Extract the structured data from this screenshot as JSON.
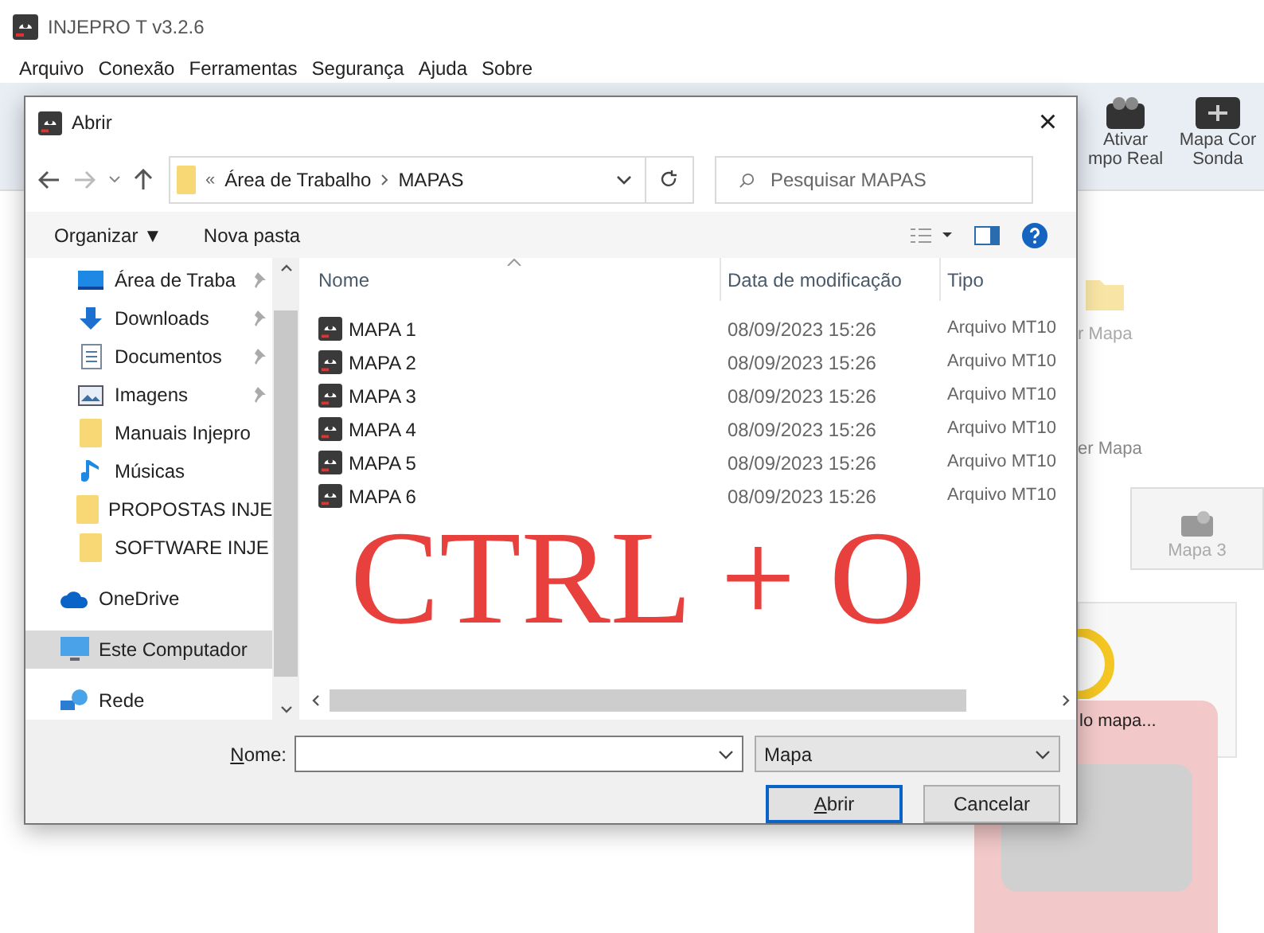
{
  "app": {
    "title": "INJEPRO T v3.2.6",
    "menu": [
      "Arquivo",
      "Conexão",
      "Ferramentas",
      "Segurança",
      "Ajuda",
      "Sobre"
    ],
    "toolbar": [
      {
        "label_lines": [
          "Ativar",
          "mpo Real"
        ],
        "kind": "device"
      },
      {
        "label_lines": [
          "Mapa Cor",
          "Sonda"
        ],
        "kind": "probe"
      }
    ],
    "panel_texts": [
      "r Mapa",
      "er Mapa"
    ],
    "map_card": {
      "label": "Mapa 3"
    },
    "loading_card": {
      "label": "lo mapa..."
    }
  },
  "dialog": {
    "title": "Abrir",
    "close": "×",
    "path": [
      "Área de Trabalho",
      "MAPAS"
    ],
    "path_prefix": "«",
    "search": {
      "placeholder": "Pesquisar MAPAS"
    },
    "commands": [
      "Organizar ▼",
      "Nova pasta"
    ],
    "nav": [
      {
        "label": "Área de Traba",
        "kind": "desktop",
        "pinned": true,
        "selected": false
      },
      {
        "label": "Downloads",
        "kind": "download",
        "pinned": true,
        "selected": false
      },
      {
        "label": "Documentos",
        "kind": "document",
        "pinned": true,
        "selected": false
      },
      {
        "label": "Imagens",
        "kind": "image",
        "pinned": true,
        "selected": false
      },
      {
        "label": "Manuais Injepro",
        "kind": "folder",
        "pinned": false,
        "selected": false
      },
      {
        "label": "Músicas",
        "kind": "music",
        "pinned": false,
        "selected": false
      },
      {
        "label": "PROPOSTAS INJE",
        "kind": "folder",
        "pinned": false,
        "selected": false
      },
      {
        "label": "SOFTWARE INJE",
        "kind": "folder",
        "pinned": false,
        "selected": false
      },
      {
        "label": "OneDrive",
        "kind": "cloud",
        "pinned": false,
        "selected": false
      },
      {
        "label": "Este Computador",
        "kind": "computer",
        "pinned": false,
        "selected": true
      },
      {
        "label": "Rede",
        "kind": "network",
        "pinned": false,
        "selected": false
      }
    ],
    "columns": [
      "Nome",
      "Data de modificação",
      "Tipo"
    ],
    "files": [
      {
        "name": "MAPA 1",
        "date": "08/09/2023 15:26",
        "type": "Arquivo MT10"
      },
      {
        "name": "MAPA 2",
        "date": "08/09/2023 15:26",
        "type": "Arquivo MT10"
      },
      {
        "name": "MAPA 3",
        "date": "08/09/2023 15:26",
        "type": "Arquivo MT10"
      },
      {
        "name": "MAPA 4",
        "date": "08/09/2023 15:26",
        "type": "Arquivo MT10"
      },
      {
        "name": "MAPA 5",
        "date": "08/09/2023 15:26",
        "type": "Arquivo MT10"
      },
      {
        "name": "MAPA 6",
        "date": "08/09/2023 15:26",
        "type": "Arquivo MT10"
      }
    ],
    "name_label": "Nome:",
    "file_type": "Mapa",
    "buttons": [
      {
        "label": "Abrir",
        "default": true
      },
      {
        "label": "Cancelar",
        "default": false
      }
    ]
  },
  "overlay_text": "CTRL + O"
}
